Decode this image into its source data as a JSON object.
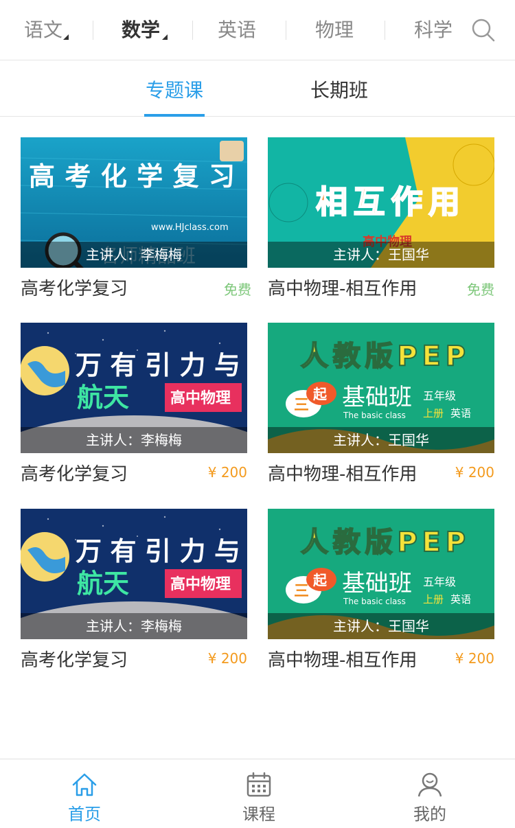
{
  "subjects": [
    {
      "label": "语文",
      "has_caret": true
    },
    {
      "label": "数学",
      "has_caret": true,
      "active": true
    },
    {
      "label": "英语"
    },
    {
      "label": "物理"
    },
    {
      "label": "科学"
    }
  ],
  "search_icon": "search-icon",
  "tabs": [
    {
      "label": "专题课",
      "active": true
    },
    {
      "label": "长期班"
    }
  ],
  "accent_color": "#2a9ee8",
  "courses": [
    {
      "title": "高考化学复习",
      "lecturer": "主讲人：李梅梅",
      "price": "免费",
      "price_type": "free",
      "thumb_text": "高考化学复习",
      "thumb_sub": "www.HJclass.com",
      "thumb_tag": "名师精品班"
    },
    {
      "title": "高中物理-相互作用",
      "lecturer": "主讲人：王国华",
      "price": "免费",
      "price_type": "free",
      "thumb_text": "相互作用",
      "thumb_tag": "高中物理"
    },
    {
      "title": "高考化学复习",
      "lecturer": "主讲人：李梅梅",
      "price": "¥ 200",
      "price_type": "paid",
      "thumb_text_1": "万有引力与",
      "thumb_text_2": "航天",
      "thumb_tag": "高中物理"
    },
    {
      "title": "高中物理-相互作用",
      "lecturer": "主讲人：王国华",
      "price": "¥ 200",
      "price_type": "paid",
      "thumb_text_1": "人教版PEP",
      "thumb_badge": "起",
      "thumb_badge_2": "三",
      "thumb_text_2": "基础班",
      "thumb_grade": "五年级",
      "thumb_term": "上册",
      "thumb_subject": "英语",
      "thumb_en": "The basic class"
    },
    {
      "title": "高考化学复习",
      "lecturer": "主讲人：李梅梅",
      "price": "¥ 200",
      "price_type": "paid",
      "thumb_text_1": "万有引力与",
      "thumb_text_2": "航天",
      "thumb_tag": "高中物理"
    },
    {
      "title": "高中物理-相互作用",
      "lecturer": "主讲人：王国华",
      "price": "¥ 200",
      "price_type": "paid",
      "thumb_text_1": "人教版PEP",
      "thumb_badge": "起",
      "thumb_badge_2": "三",
      "thumb_text_2": "基础班",
      "thumb_grade": "五年级",
      "thumb_term": "上册",
      "thumb_subject": "英语",
      "thumb_en": "The basic class"
    }
  ],
  "nav": [
    {
      "label": "首页",
      "icon": "home-icon",
      "active": true
    },
    {
      "label": "课程",
      "icon": "calendar-icon"
    },
    {
      "label": "我的",
      "icon": "user-icon"
    }
  ]
}
